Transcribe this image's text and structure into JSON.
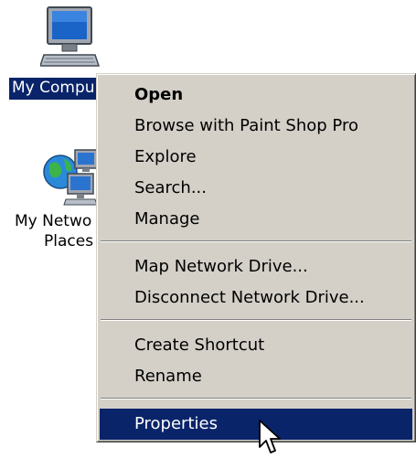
{
  "desktop": {
    "my_computer": {
      "label": "My Compu",
      "icon": "computer-icon"
    },
    "my_network": {
      "label_line1": "My Netwo",
      "label_line2": "Places",
      "icon": "network-places-icon"
    }
  },
  "context_menu": {
    "items": [
      {
        "label": "Open",
        "default": true
      },
      {
        "label": "Browse with Paint Shop Pro"
      },
      {
        "label": "Explore"
      },
      {
        "label": "Search..."
      },
      {
        "label": "Manage"
      },
      {
        "label": "Map Network Drive..."
      },
      {
        "label": "Disconnect Network Drive..."
      },
      {
        "label": "Create Shortcut"
      },
      {
        "label": "Rename"
      },
      {
        "label": "Properties",
        "selected": true
      }
    ]
  },
  "colors": {
    "menu_bg": "#d4d0c8",
    "highlight": "#0a246a",
    "highlight_text": "#ffffff"
  },
  "cursor": {
    "icon": "mouse-pointer-icon"
  }
}
